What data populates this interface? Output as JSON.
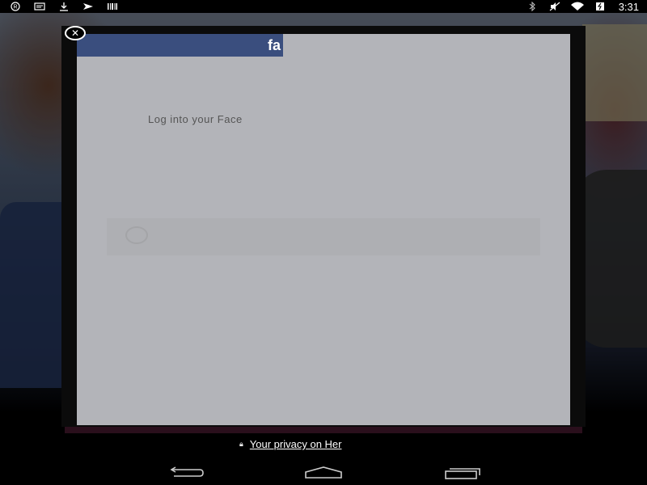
{
  "status_bar": {
    "left_icons": [
      "registered-icon",
      "message-icon",
      "download-icon",
      "send-icon",
      "barcode-icon"
    ],
    "right_icons": [
      "bluetooth-icon",
      "mute-icon",
      "wifi-icon",
      "battery-icon"
    ],
    "time": "3:31"
  },
  "dialog": {
    "brand_text": "fa",
    "login_text": "Log into your Face",
    "close_icon": "close-icon"
  },
  "footer": {
    "privacy_text": "Your privacy on Her",
    "lock_icon": "lock-icon"
  },
  "nav": {
    "back_icon": "back-icon",
    "home_icon": "home-icon",
    "recent_icon": "recent-apps-icon"
  },
  "colors": {
    "facebook_blue": "#3a4e7e",
    "dialog_bg": "#b3b4b9",
    "status_bar_bg": "#000000"
  }
}
